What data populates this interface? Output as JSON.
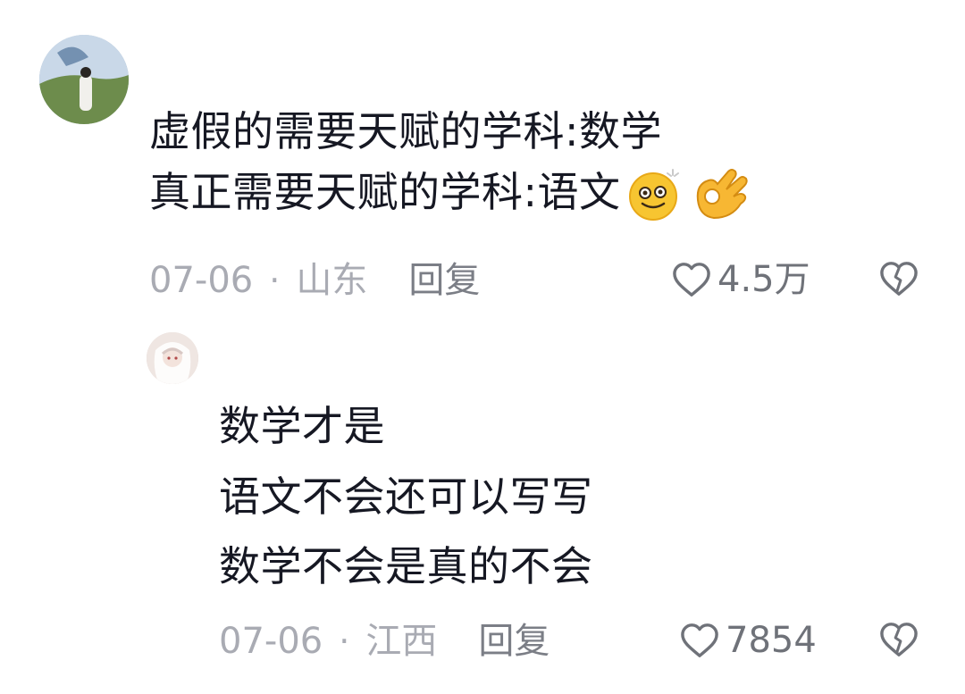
{
  "comment": {
    "text_lines": [
      "虚假的需要天赋的学科:数学",
      "真正需要天赋的学科:语文"
    ],
    "emojis": [
      "dizzy-face-emoji",
      "ok-hand-emoji"
    ],
    "date": "07-06",
    "separator": "·",
    "location": "山东",
    "reply_label": "回复",
    "likes": "4.5万"
  },
  "reply": {
    "text_lines": [
      "数学才是",
      "语文不会还可以写写",
      "数学不会是真的不会"
    ],
    "date": "07-06",
    "separator": "·",
    "location": "江西",
    "reply_label": "回复",
    "likes": "7854"
  },
  "colors": {
    "text": "#161823",
    "meta": "#a9abb3",
    "reply": "#7b7e86",
    "icon": "#6f7279"
  }
}
